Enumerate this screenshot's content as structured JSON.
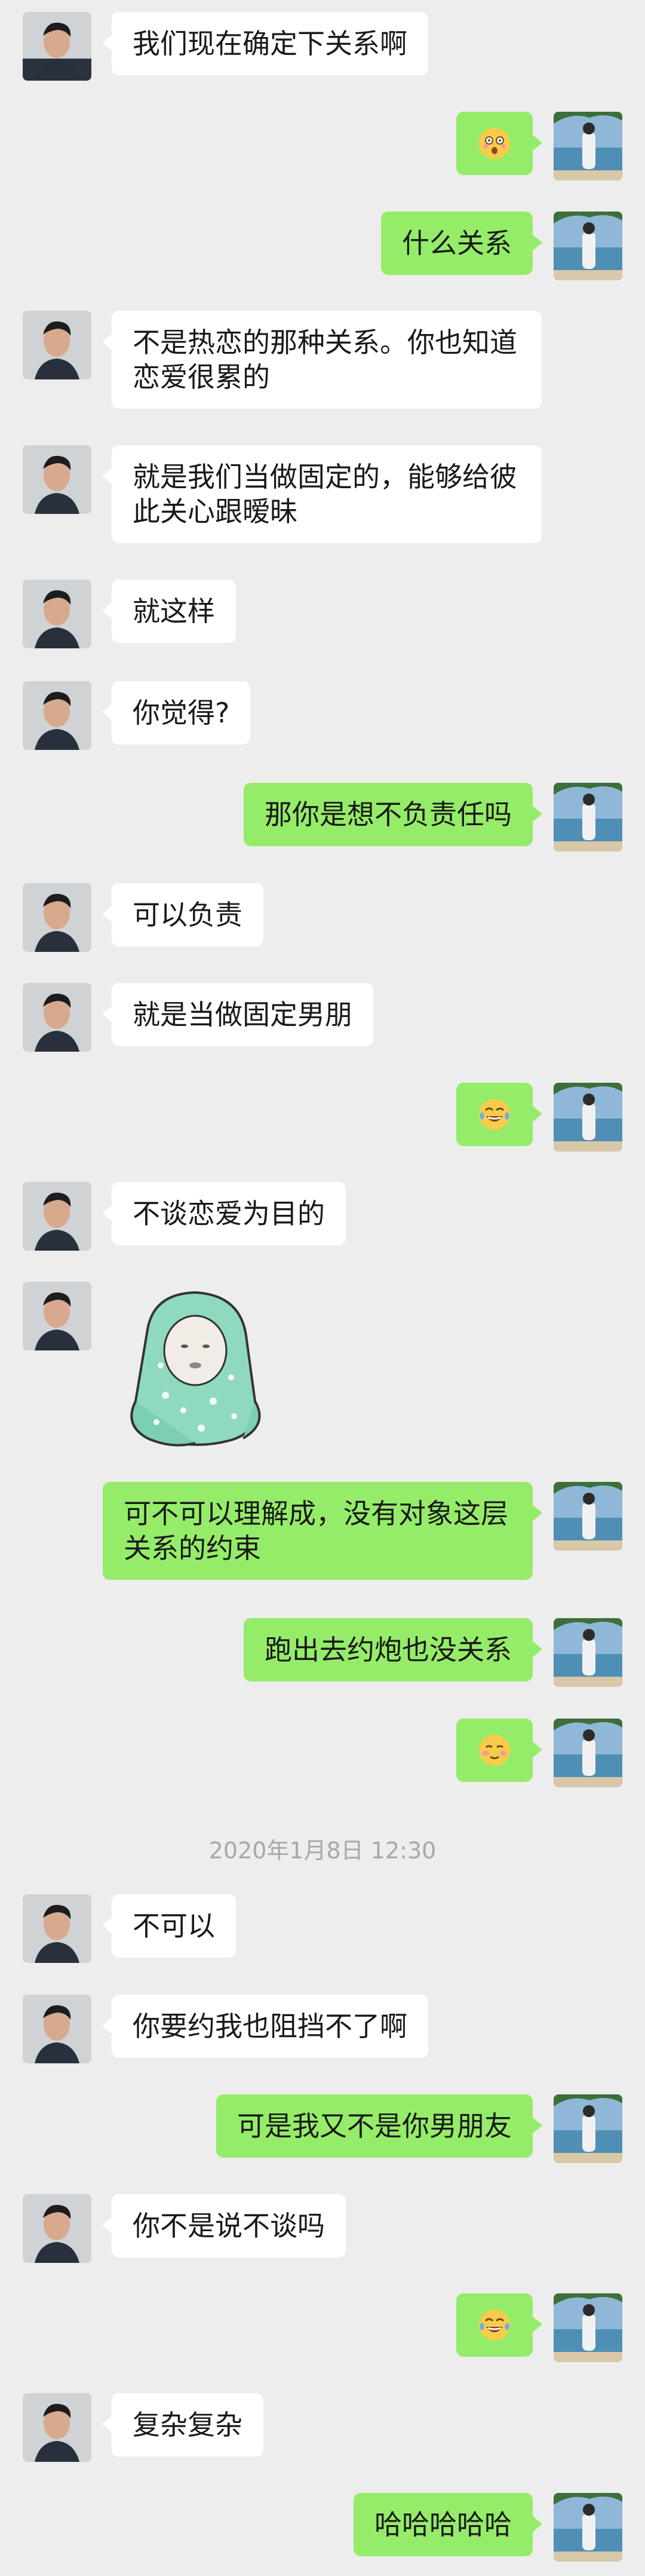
{
  "colors": {
    "background": "#ededed",
    "incoming_bubble": "#ffffff",
    "outgoing_bubble": "#95ec69",
    "timestamp_text": "#a8a8a8"
  },
  "messages": [
    {
      "side": "in",
      "text": "我们现在确定下关系啊"
    },
    {
      "side": "out",
      "emoji": "dizzy-face-emoji"
    },
    {
      "side": "out",
      "text": "什么关系"
    },
    {
      "side": "in",
      "text": "不是热恋的那种关系。你也知道恋爱很累的"
    },
    {
      "side": "in",
      "text": "就是我们当做固定的，能够给彼此关心跟暧昧"
    },
    {
      "side": "in",
      "text": "就这样"
    },
    {
      "side": "in",
      "text": "你觉得?"
    },
    {
      "side": "out",
      "text": "那你是想不负责任吗"
    },
    {
      "side": "in",
      "text": "可以负责"
    },
    {
      "side": "in",
      "text": "就是当做固定男朋"
    },
    {
      "side": "out",
      "emoji": "tears-of-joy-emoji"
    },
    {
      "side": "in",
      "text": "不谈恋爱为目的"
    },
    {
      "side": "in",
      "sticker": "baby-in-blanket-sticker"
    },
    {
      "side": "out",
      "text": "可不可以理解成，没有对象这层关系的约束"
    },
    {
      "side": "out",
      "text": "跑出去约炮也没关系"
    },
    {
      "side": "out",
      "emoji": "blushing-face-emoji"
    },
    {
      "side": "timestamp",
      "text": "2020年1月8日 12:30"
    },
    {
      "side": "in",
      "text": "不可以"
    },
    {
      "side": "in",
      "text": "你要约我也阻挡不了啊"
    },
    {
      "side": "out",
      "text": "可是我又不是你男朋友"
    },
    {
      "side": "in",
      "text": "你不是说不谈吗"
    },
    {
      "side": "out",
      "emoji": "tears-of-joy-emoji"
    },
    {
      "side": "in",
      "text": "复杂复杂"
    },
    {
      "side": "out",
      "text": "哈哈哈哈哈"
    }
  ]
}
